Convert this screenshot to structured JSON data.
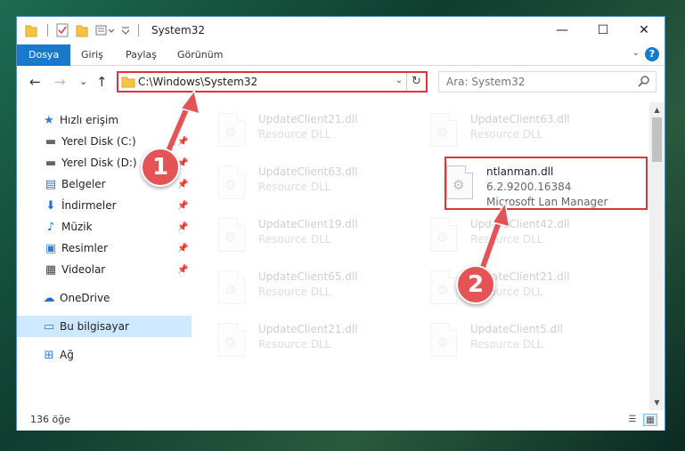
{
  "window": {
    "title": "System32",
    "controls": {
      "minimize": "—",
      "maximize": "☐",
      "close": "✕"
    }
  },
  "ribbon": {
    "tabs": [
      {
        "label": "Dosya",
        "active": true
      },
      {
        "label": "Giriş"
      },
      {
        "label": "Paylaş"
      },
      {
        "label": "Görünüm"
      }
    ],
    "help": "?",
    "expand": "⌄"
  },
  "nav": {
    "back": "←",
    "forward": "→",
    "recent": "⌄",
    "up": "↑",
    "address": "C:\\Windows\\System32",
    "address_dropdown": "⌄",
    "refresh": "↻",
    "search_placeholder": "Ara: System32"
  },
  "sidebar": {
    "items": [
      {
        "label": "Hızlı erişim",
        "icon": "star-icon",
        "glyph": "★",
        "color": "#2f7fd1"
      },
      {
        "label": "Yerel Disk (C:)",
        "icon": "drive-icon",
        "glyph": "▬",
        "color": "#666666",
        "pin": "📌"
      },
      {
        "label": "Yerel Disk (D:)",
        "icon": "drive-icon",
        "glyph": "▬",
        "color": "#666666",
        "pin": "📌"
      },
      {
        "label": "Belgeler",
        "icon": "documents-icon",
        "glyph": "▤",
        "color": "#4a6fa5",
        "pin": "📌"
      },
      {
        "label": "İndirmeler",
        "icon": "download-icon",
        "glyph": "⬇",
        "color": "#1e6fd0",
        "pin": "📌"
      },
      {
        "label": "Müzik",
        "icon": "music-icon",
        "glyph": "♪",
        "color": "#1e6fd0",
        "pin": "📌"
      },
      {
        "label": "Resimler",
        "icon": "pictures-icon",
        "glyph": "▣",
        "color": "#3a7fc0",
        "pin": "📌"
      },
      {
        "label": "Videolar",
        "icon": "video-icon",
        "glyph": "▦",
        "color": "#444444",
        "pin": "📌"
      },
      {
        "label": "OneDrive",
        "icon": "cloud-icon",
        "glyph": "☁",
        "color": "#1e6fd0"
      },
      {
        "label": "Bu bilgisayar",
        "icon": "computer-icon",
        "glyph": "▭",
        "color": "#2f7fd1",
        "selected": true
      },
      {
        "label": "Ağ",
        "icon": "network-icon",
        "glyph": "⊞",
        "color": "#2f7fd1"
      }
    ]
  },
  "files": [
    {
      "name": "UpdateClient21.dll",
      "sub1": "Resource DLL"
    },
    {
      "name": "UpdateClient63.dll",
      "sub1": "Resource DLL"
    },
    {
      "name": "UpdateClient63.dll",
      "sub1": "Resource DLL"
    },
    {
      "name": "ntlanman.dll",
      "sub1": "6.2.9200.16384",
      "sub2": "Microsoft Lan Manager",
      "highlighted": true
    },
    {
      "name": "UpdateClient19.dll",
      "sub1": "Resource DLL"
    },
    {
      "name": "UpdateClient42.dll",
      "sub1": "Resource DLL"
    },
    {
      "name": "UpdateClient65.dll",
      "sub1": "Resource DLL"
    },
    {
      "name": "UpdateClient21.dll",
      "sub1": "Resource DLL"
    },
    {
      "name": "UpdateClient21.dll",
      "sub1": "Resource DLL"
    },
    {
      "name": "UpdateClient5.dll",
      "sub1": "Resource DLL"
    }
  ],
  "status": {
    "count": "136 öğe",
    "details_view": "☰",
    "tiles_view": "▦"
  },
  "annotations": [
    {
      "number": "1"
    },
    {
      "number": "2"
    }
  ],
  "colors": {
    "accent": "#1979ca",
    "highlight": "#e03436",
    "badge": "#e45457"
  }
}
